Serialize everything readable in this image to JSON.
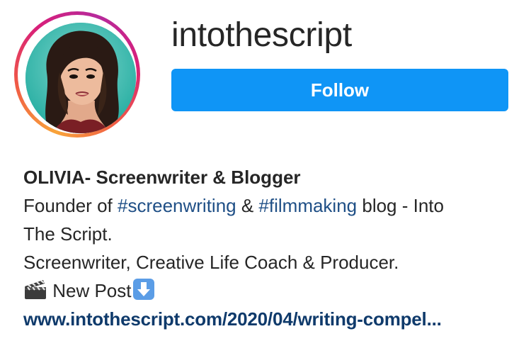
{
  "profile": {
    "username": "intothescript",
    "follow_label": "Follow",
    "avatar_icon": "profile-photo"
  },
  "bio": {
    "name": "OLIVIA- Screenwriter & Blogger",
    "line1_prefix": "Founder of ",
    "hashtag1": "#screenwriting",
    "line1_mid": " & ",
    "hashtag2": "#filmmaking",
    "line1_suffix": " blog - Into",
    "line2": "The Script.",
    "line3": "Screenwriter, Creative Life Coach & Producer.",
    "line4_text": " New Post",
    "line4_icons": [
      "clapper-board-icon",
      "down-arrow-icon"
    ],
    "link": "www.intothescript.com/2020/04/writing-compel..."
  },
  "colors": {
    "follow_button": "#0f95f6",
    "hashtag": "#1f4f86",
    "link": "#0f3a6b",
    "text": "#262626"
  }
}
